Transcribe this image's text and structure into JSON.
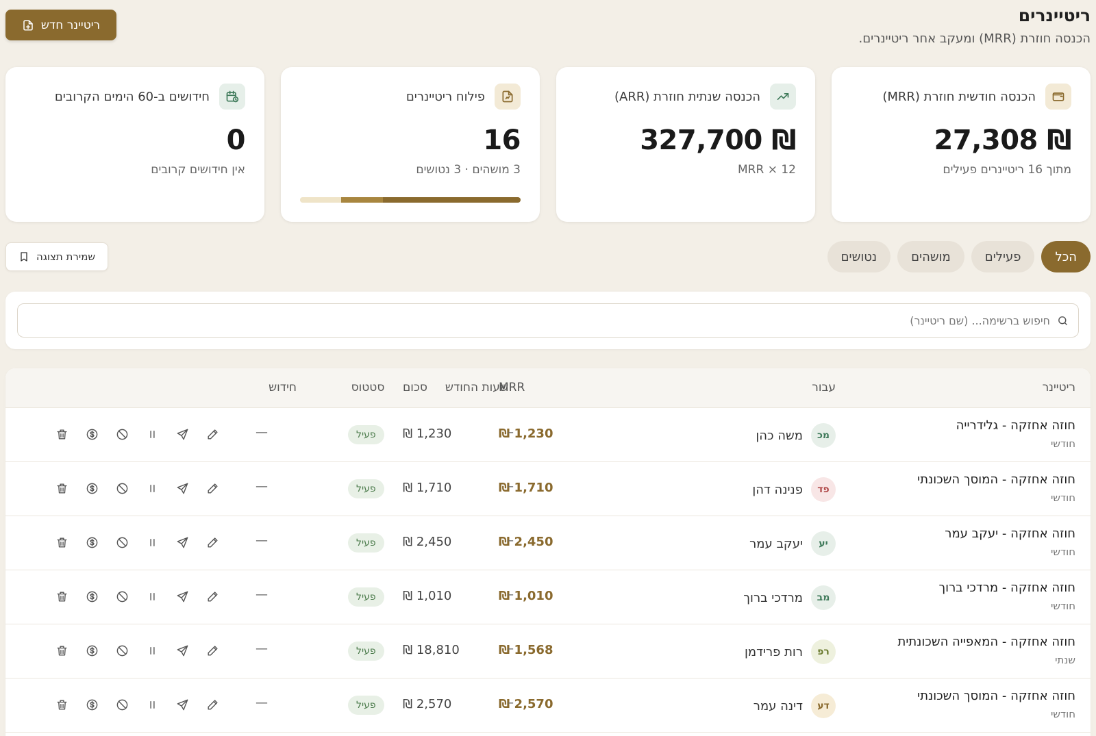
{
  "header": {
    "title": "ריטיינרים",
    "subtitle": "הכנסה חוזרת (MRR) ומעקב אחר ריטיינרים.",
    "new_button": "ריטיינר חדש"
  },
  "cards": [
    {
      "label": "הכנסה חודשית חוזרת (MRR)",
      "value": "₪ 27,308",
      "sub": "מתוך 16 ריטיינרים פעילים",
      "icon": "wallet-icon"
    },
    {
      "label": "הכנסה שנתית חוזרת (ARR)",
      "value": "₪ 327,700",
      "sub": "MRR × 12",
      "icon": "trending-up-icon"
    },
    {
      "label": "פילוח ריטיינרים",
      "value": "16",
      "sub": "3 מושהים · 3 נטושים",
      "icon": "document-icon"
    },
    {
      "label": "חידושים ב-60 הימים הקרובים",
      "value": "0",
      "sub": "אין חידושים קרובים",
      "icon": "calendar-clock-icon"
    }
  ],
  "breakdown": {
    "total": 16,
    "active": 10,
    "paused": 3,
    "abandoned": 3
  },
  "tabs": [
    "הכל",
    "פעילים",
    "מושהים",
    "נטושים"
  ],
  "save_view": "שמירת תצוגה",
  "search": {
    "placeholder": "חיפוש ברשימה... (שם ריטיינר)"
  },
  "table": {
    "headers": [
      "ריטיינר",
      "עבור",
      "סכום",
      "MRR",
      "שעות החודש",
      "סטטוס",
      "חידוש"
    ],
    "rows": [
      {
        "name": "חוזה אחזקה - גלידרייה",
        "period": "חודשי",
        "initials": "מכ",
        "client": "משה כהן",
        "amount": "₪ 1,230",
        "mrr": "₪ 1,230",
        "hours": "–",
        "status": "פעיל",
        "renewal": "—"
      },
      {
        "name": "חוזה אחזקה - המוסך השכונתי",
        "period": "חודשי",
        "initials": "פד",
        "client": "פנינה דהן",
        "amount": "₪ 1,710",
        "mrr": "₪ 1,710",
        "hours": "–",
        "status": "פעיל",
        "renewal": "—"
      },
      {
        "name": "חוזה אחזקה - יעקב עמר",
        "period": "חודשי",
        "initials": "יע",
        "client": "יעקב עמר",
        "amount": "₪ 2,450",
        "mrr": "₪ 2,450",
        "hours": "–",
        "status": "פעיל",
        "renewal": "—"
      },
      {
        "name": "חוזה אחזקה - מרדכי ברוך",
        "period": "חודשי",
        "initials": "מב",
        "client": "מרדכי ברוך",
        "amount": "₪ 1,010",
        "mrr": "₪ 1,010",
        "hours": "–",
        "status": "פעיל",
        "renewal": "—"
      },
      {
        "name": "חוזה אחזקה - המאפייה השכונתית",
        "period": "שנתי",
        "initials": "רפ",
        "client": "רות פרידמן",
        "amount": "₪ 18,810",
        "mrr": "₪ 1,568",
        "hours": "–",
        "status": "פעיל",
        "renewal": "—"
      },
      {
        "name": "חוזה אחזקה - המוסך השכונתי",
        "period": "חודשי",
        "initials": "דע",
        "client": "דינה עמר",
        "amount": "₪ 2,570",
        "mrr": "₪ 2,570",
        "hours": "–",
        "status": "פעיל",
        "renewal": "—"
      }
    ]
  },
  "colors": {
    "accent": "#8a6a2e",
    "status_active_bg": "#e8f0e6",
    "status_active_text": "#4a7a4a"
  }
}
